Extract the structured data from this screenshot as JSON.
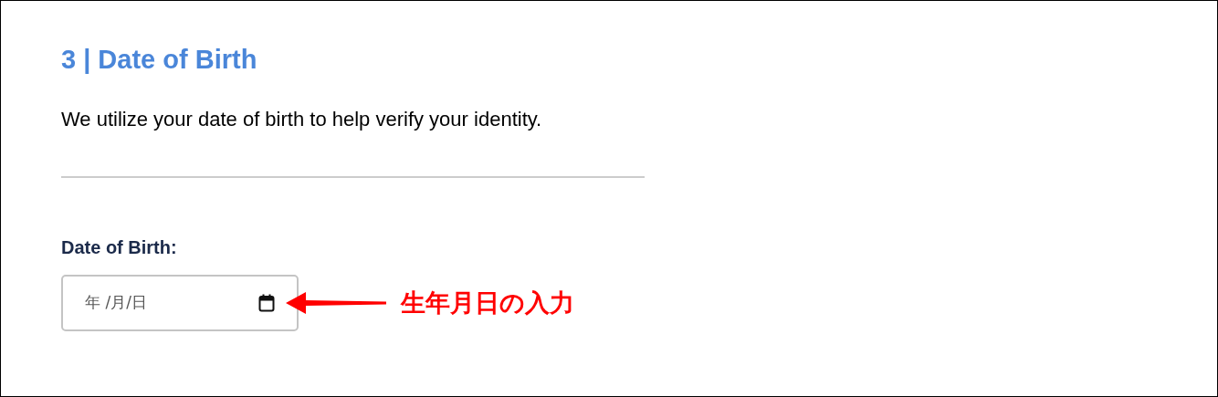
{
  "section": {
    "title": "3 | Date of Birth",
    "description": "We utilize your date of birth to help verify your identity."
  },
  "field": {
    "label": "Date of Birth:",
    "placeholder": "年 /月/日"
  },
  "annotation": {
    "text": "生年月日の入力"
  }
}
